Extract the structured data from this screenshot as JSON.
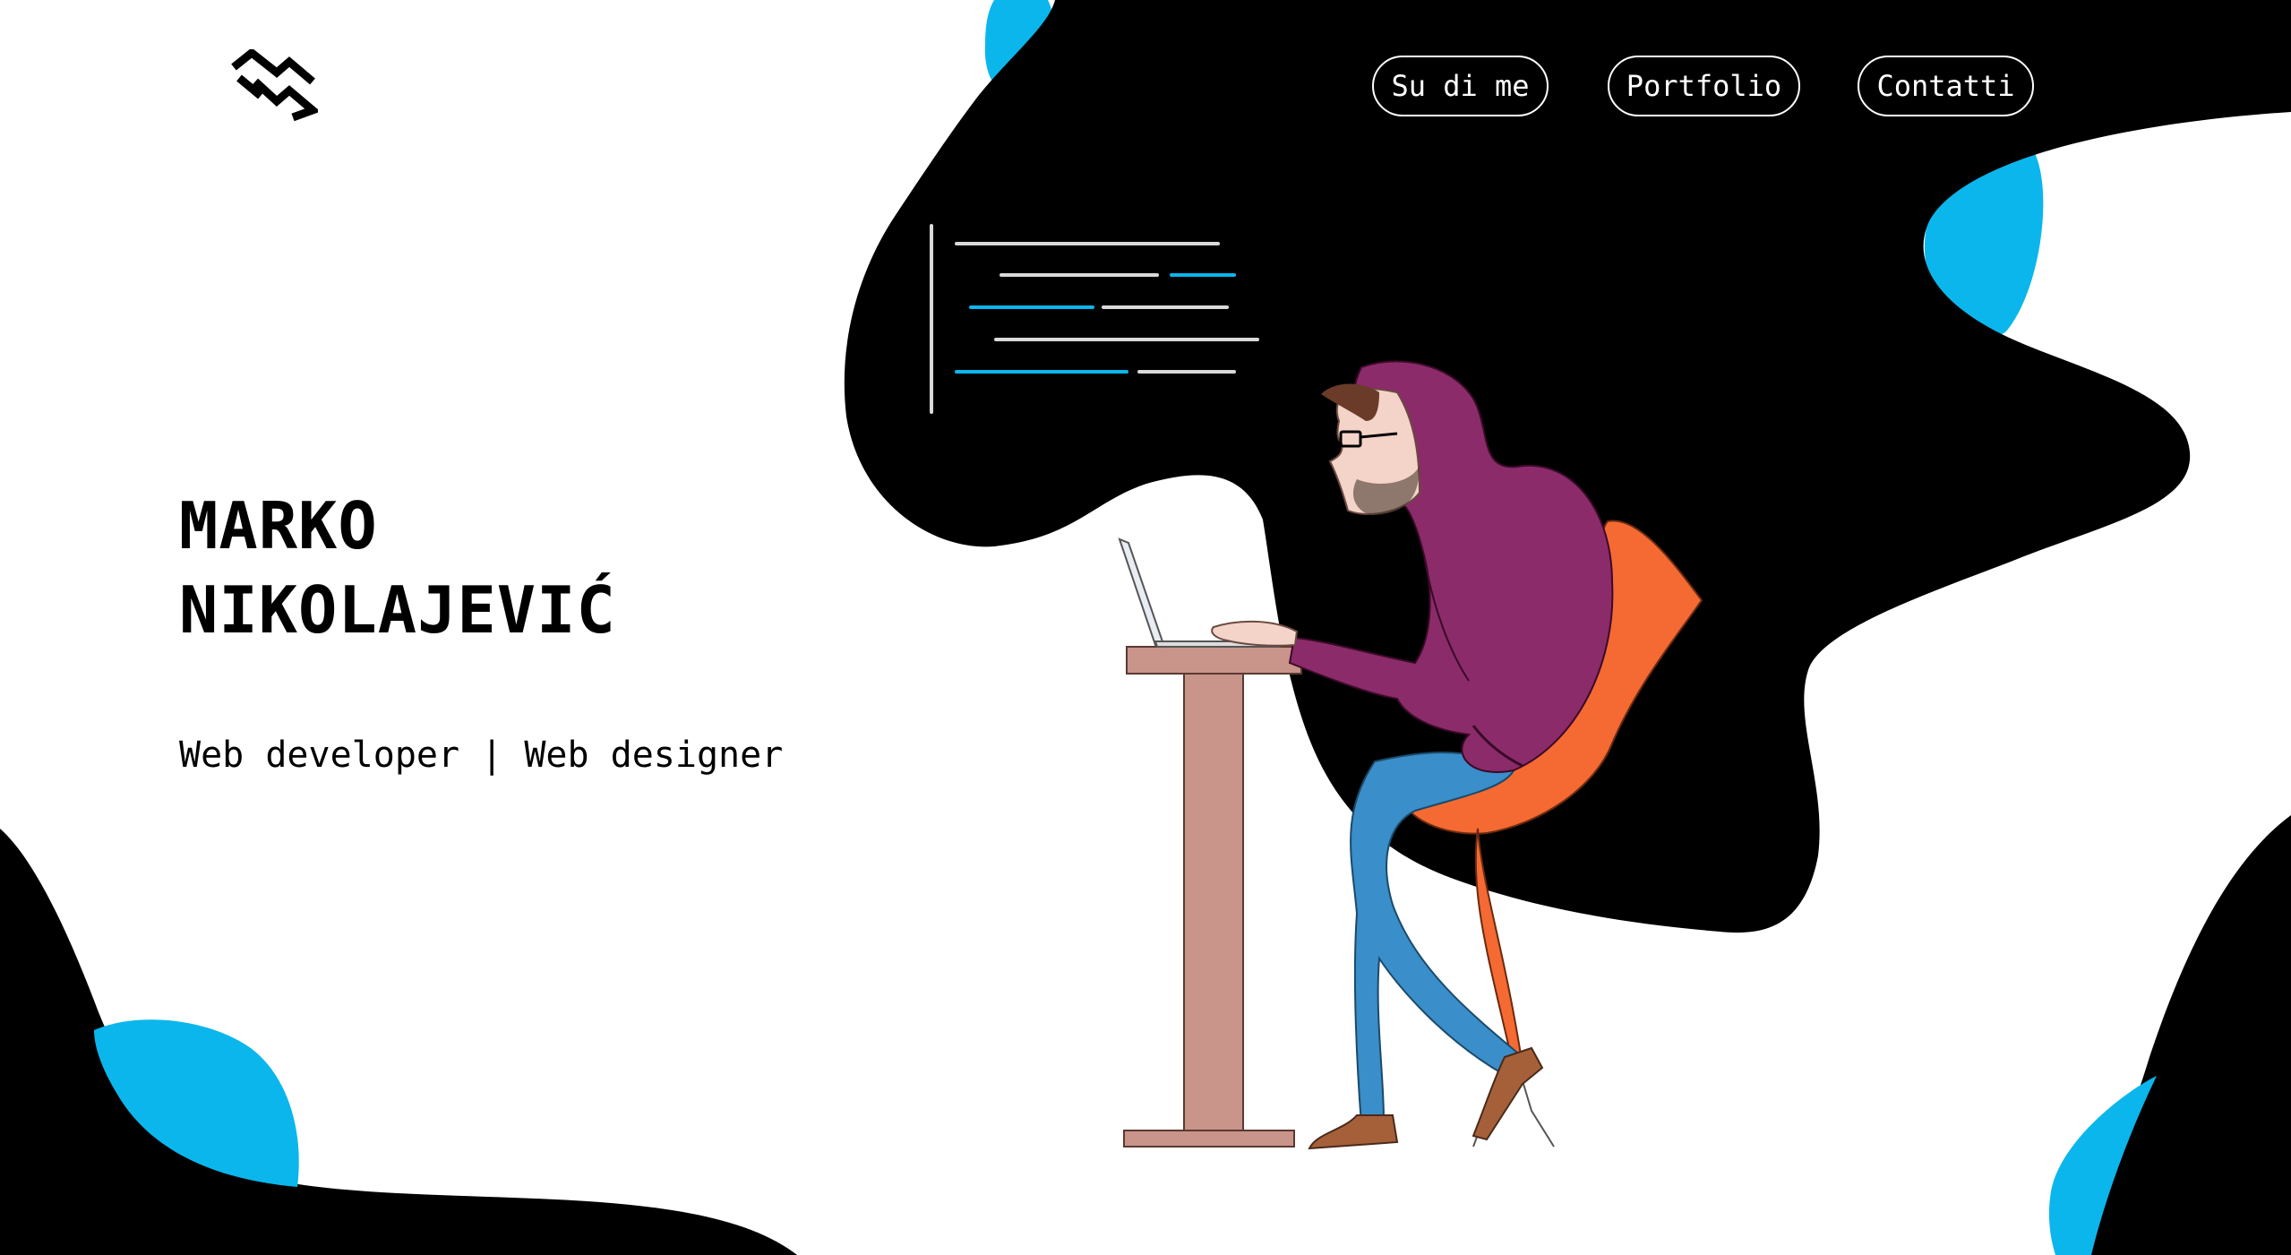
{
  "colors": {
    "accent": "#0bb6ec",
    "background": "#ffffff",
    "dark": "#000000",
    "hoodie": "#8b2b6a",
    "chair": "#f46a32",
    "jeans": "#3a8ec9",
    "desk": "#c9948a"
  },
  "nav": {
    "items": [
      {
        "label": "Su di me"
      },
      {
        "label": "Portfolio"
      },
      {
        "label": "Contatti"
      }
    ]
  },
  "hero": {
    "name_line1": "MARKO",
    "name_line2": "NIKOLAJEVIĆ",
    "subtitle": "Web developer | Web designer"
  },
  "icons": {
    "logo": "mn-logo-icon",
    "code": "code-lines-icon"
  }
}
